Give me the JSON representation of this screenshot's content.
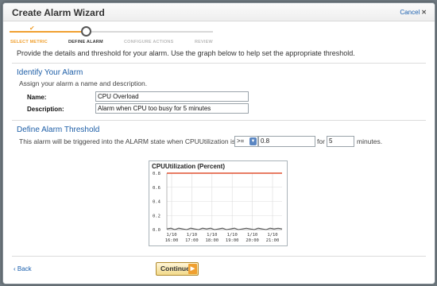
{
  "dialog": {
    "title": "Create Alarm Wizard",
    "cancel_label": "Cancel"
  },
  "wizard": {
    "steps": [
      {
        "label": "SELECT METRIC",
        "state": "done"
      },
      {
        "label": "DEFINE ALARM",
        "state": "current"
      },
      {
        "label": "CONFIGURE ACTIONS",
        "state": "upcoming"
      },
      {
        "label": "REVIEW",
        "state": "upcoming"
      }
    ],
    "colors": {
      "done": "#f0a030",
      "upcoming": "#d8d8d8"
    }
  },
  "intro": "Provide the details and threshold for your alarm. Use the graph below to help set the appropriate threshold.",
  "identify": {
    "heading": "Identify Your Alarm",
    "subtitle": "Assign your alarm a name and description.",
    "name_label": "Name:",
    "name_value": "CPU Overload",
    "description_label": "Description:",
    "description_value": "Alarm when CPU too busy for 5 minutes"
  },
  "threshold": {
    "heading": "Define Alarm Threshold",
    "prefix": "This alarm will be triggered into the ALARM state when CPUUtilization is",
    "operator": ">=",
    "value": "0.8",
    "for_label": "for",
    "periods": "5",
    "suffix": "minutes."
  },
  "chart_data": {
    "type": "line",
    "title": "CPUUtilization (Percent)",
    "ylim": [
      0.0,
      0.8
    ],
    "yticks": [
      "0.8",
      "0.6",
      "0.4",
      "0.2",
      "0.0"
    ],
    "x": [
      "1/10 16:00",
      "1/10 17:00",
      "1/10 18:00",
      "1/10 19:00",
      "1/10 20:00",
      "1/10 21:00"
    ],
    "threshold": 0.8,
    "threshold_color": "#e05030",
    "series_color": "#555555",
    "grid": true,
    "series": [
      {
        "values": [
          0.01,
          0.02,
          0.0,
          0.02,
          0.01,
          0.0,
          0.02,
          0.01,
          0.0,
          0.02,
          0.01,
          0.02,
          0.0,
          0.01,
          0.02,
          0.0,
          0.01,
          0.02,
          0.0,
          0.01,
          0.02,
          0.01,
          0.0,
          0.02,
          0.01,
          0.0,
          0.02,
          0.01,
          0.02,
          0.01
        ]
      }
    ]
  },
  "footer": {
    "back_label": "Back",
    "continue_label": "Continue"
  }
}
